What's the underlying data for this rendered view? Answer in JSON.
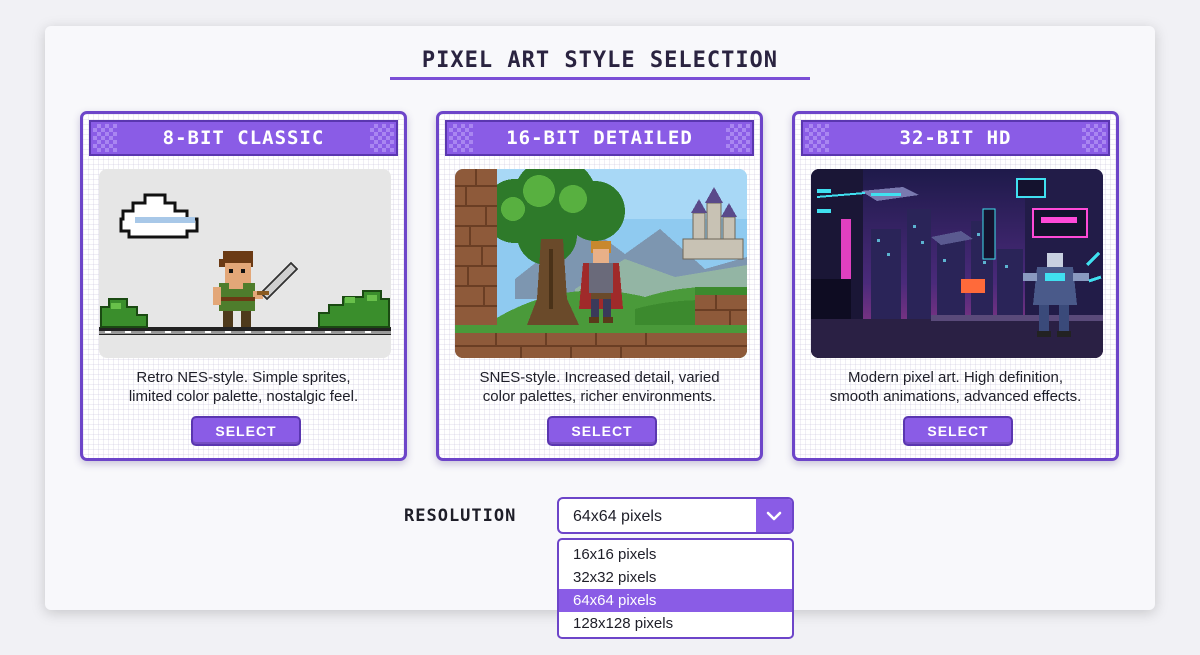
{
  "page": {
    "title": "PIXEL ART STYLE SELECTION"
  },
  "cards": [
    {
      "title": "8-BIT CLASSIC",
      "art_icon": "8bit-hero-scene-icon",
      "description_line1": "Retro NES-style. Simple sprites,",
      "description_line2": "limited color palette, nostalgic feel.",
      "button_label": "SELECT"
    },
    {
      "title": "16-BIT DETAILED",
      "art_icon": "16bit-castle-landscape-icon",
      "description_line1": "SNES-style. Increased detail, varied",
      "description_line2": "color palettes, richer environments.",
      "button_label": "SELECT"
    },
    {
      "title": "32-BIT HD",
      "art_icon": "32bit-cyberpunk-city-icon",
      "description_line1": "Modern pixel art. High definition,",
      "description_line2": "smooth animations, advanced effects.",
      "button_label": "SELECT"
    }
  ],
  "resolution": {
    "label": "RESOLUTION",
    "value": "64x64 pixels",
    "options": [
      "16x16 pixels",
      "32x32 pixels",
      "64x64 pixels",
      "128x128 pixels"
    ],
    "selected_index": 2,
    "dropdown_icon": "chevron-down-icon"
  },
  "colors": {
    "accent": "#8a5ce6",
    "accent_dark": "#5a36b0",
    "text": "#1e1e28"
  }
}
